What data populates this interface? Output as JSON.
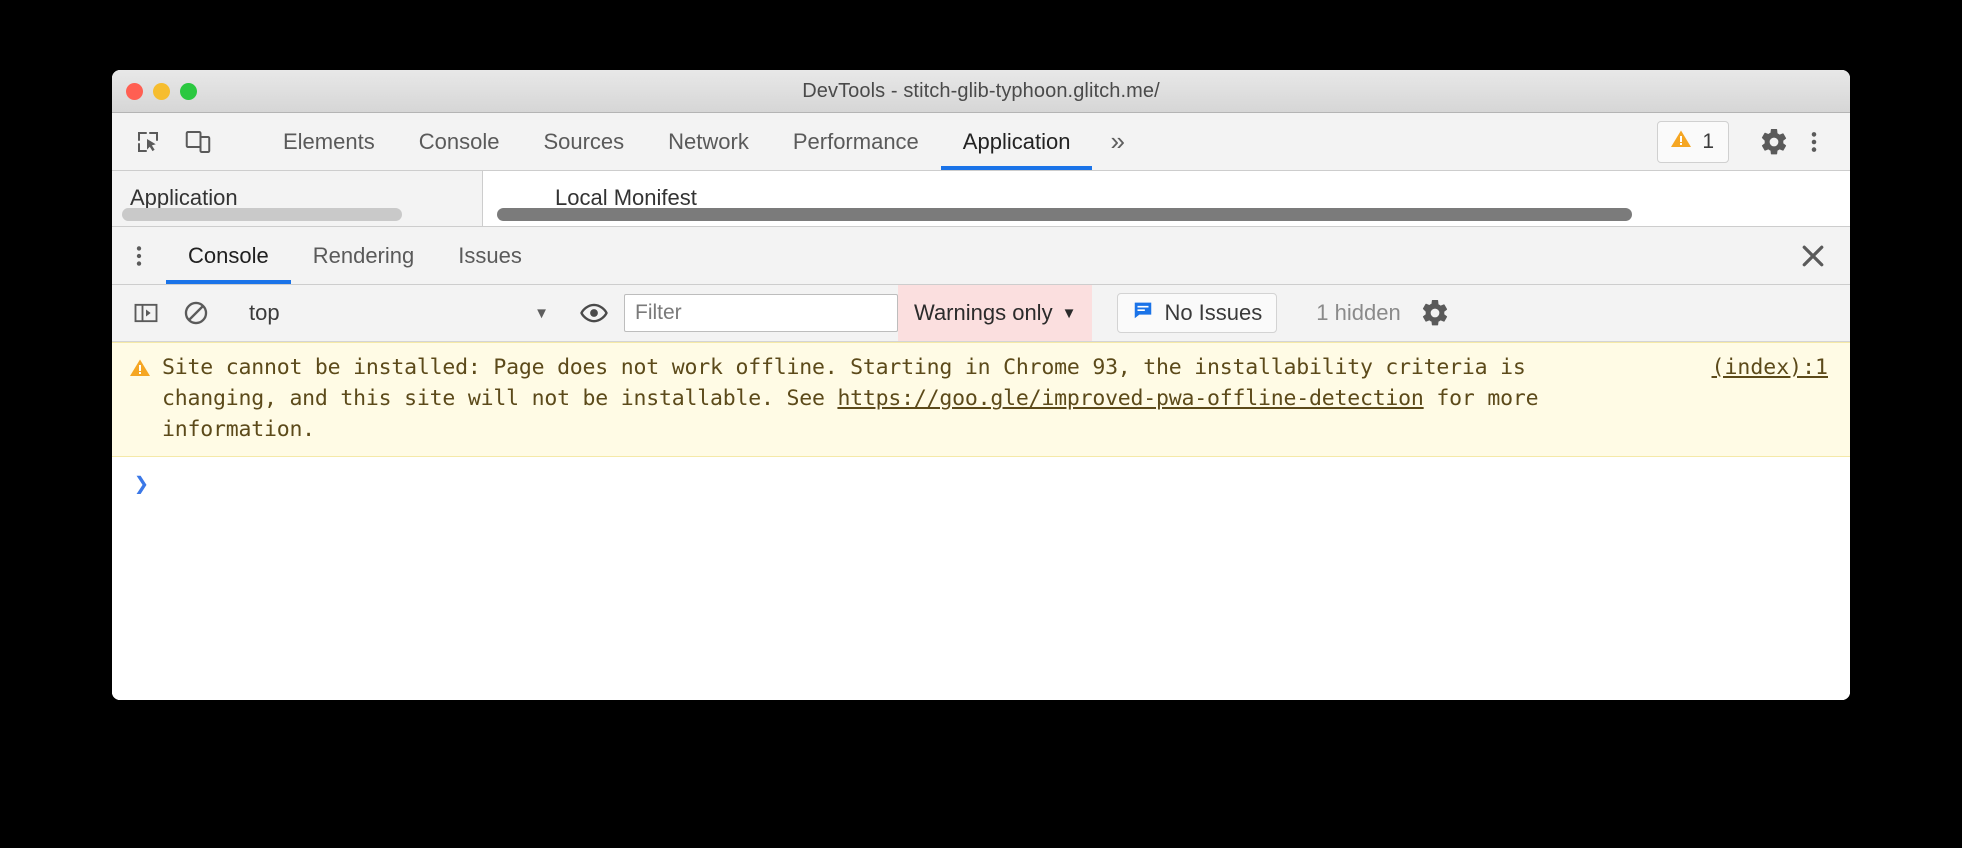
{
  "window": {
    "title": "DevTools - stitch-glib-typhoon.glitch.me/",
    "traffic_lights": {
      "close": "close-window",
      "minimize": "minimize-window",
      "maximize": "maximize-window"
    }
  },
  "devtools_toolbar": {
    "inspect_icon": "inspect-element-icon",
    "device_icon": "device-toolbar-icon",
    "tabs": [
      {
        "label": "Elements",
        "active": false
      },
      {
        "label": "Console",
        "active": false
      },
      {
        "label": "Sources",
        "active": false
      },
      {
        "label": "Network",
        "active": false
      },
      {
        "label": "Performance",
        "active": false
      },
      {
        "label": "Application",
        "active": true
      }
    ],
    "overflow_label": "»",
    "warning_badge": {
      "icon": "warning-triangle-icon",
      "count": "1"
    },
    "settings_icon": "gear-icon",
    "more_icon": "kebab-menu-icon",
    "accent_color": "#1a73e8",
    "warning_color": "#f5a623"
  },
  "application_panel": {
    "sidebar_title": "Application",
    "main_title": "Local Monifest",
    "sidebar_scrollbar": "horizontal-scrollbar",
    "main_scrollbar": "horizontal-scrollbar"
  },
  "drawer": {
    "menu_icon": "kebab-menu-icon",
    "tabs": [
      {
        "label": "Console",
        "active": true
      },
      {
        "label": "Rendering",
        "active": false
      },
      {
        "label": "Issues",
        "active": false
      }
    ],
    "close_icon": "close-icon"
  },
  "console_toolbar": {
    "sidebar_toggle_icon": "console-sidebar-icon",
    "clear_icon": "clear-console-icon",
    "context": {
      "value": "top",
      "caret": "▼"
    },
    "eye_icon": "live-expression-eye-icon",
    "filter": {
      "placeholder": "Filter",
      "value": ""
    },
    "level": {
      "value": "Warnings only",
      "caret": "▼",
      "background": "#fbdfdf"
    },
    "issues": {
      "icon": "issues-message-icon",
      "label": "No Issues",
      "icon_color": "#1a73e8"
    },
    "hidden_count": "1 hidden",
    "settings_icon": "gear-icon"
  },
  "console_messages": [
    {
      "level": "warning",
      "icon": "warning-triangle-icon",
      "text_before_link": "Site cannot be installed: Page does not work offline. Starting in Chrome 93, the installability criteria is changing, and this site will not be installable. See ",
      "link_text": "https://goo.gle/improved-pwa-offline-detection",
      "text_after_link": " for more information.",
      "source": "(index):1",
      "background": "#fffbe5",
      "text_color": "#5c4a1a"
    }
  ],
  "console_prompt": {
    "chevron": "›",
    "value": "",
    "chevron_color": "#3b78e7"
  }
}
